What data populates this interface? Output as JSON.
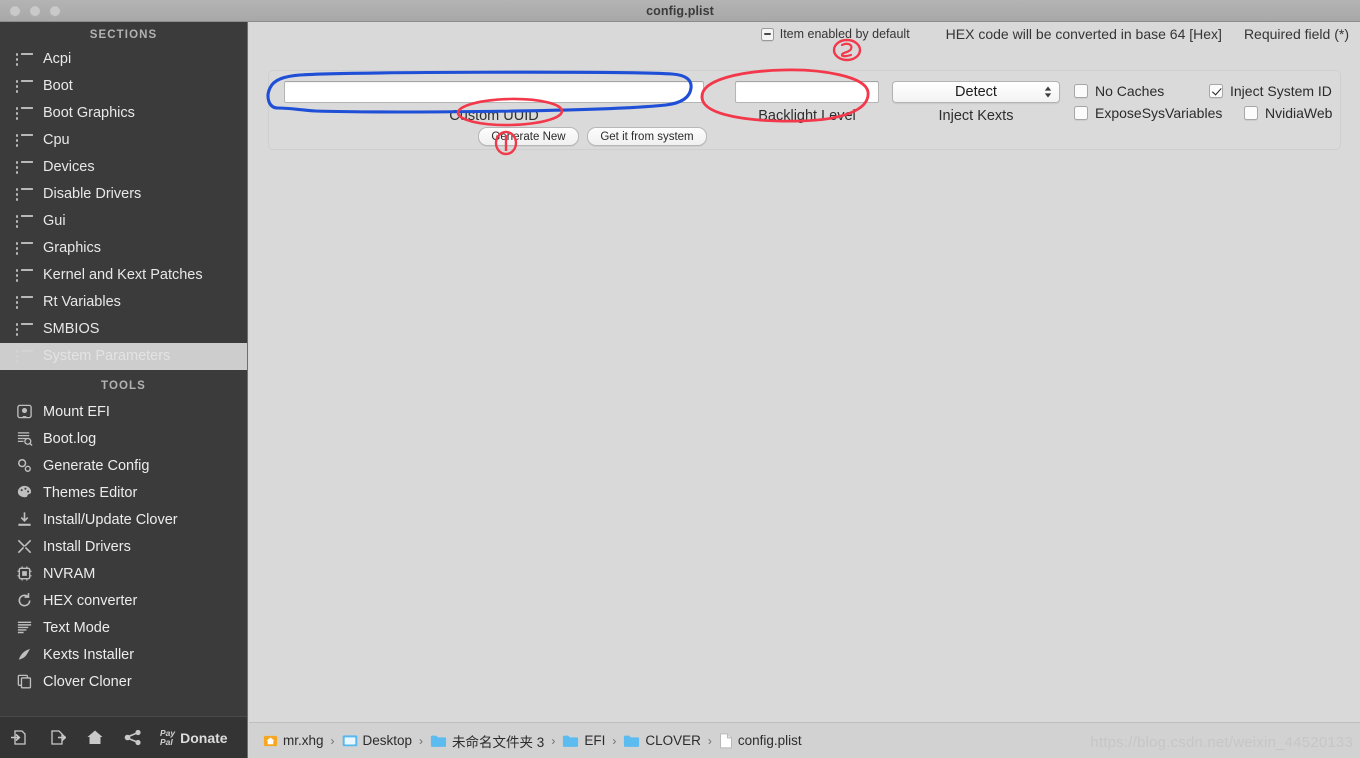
{
  "window": {
    "title": "config.plist"
  },
  "sidebar": {
    "sections_header": "SECTIONS",
    "sections": [
      {
        "label": "Acpi",
        "icon": "list-icon",
        "selected": false
      },
      {
        "label": "Boot",
        "icon": "list-icon",
        "selected": false
      },
      {
        "label": "Boot Graphics",
        "icon": "list-icon",
        "selected": false
      },
      {
        "label": "Cpu",
        "icon": "list-icon",
        "selected": false
      },
      {
        "label": "Devices",
        "icon": "list-icon",
        "selected": false
      },
      {
        "label": "Disable Drivers",
        "icon": "list-icon",
        "selected": false
      },
      {
        "label": "Gui",
        "icon": "list-icon",
        "selected": false
      },
      {
        "label": "Graphics",
        "icon": "list-icon",
        "selected": false
      },
      {
        "label": "Kernel and Kext Patches",
        "icon": "list-icon",
        "selected": false
      },
      {
        "label": "Rt Variables",
        "icon": "list-icon",
        "selected": false
      },
      {
        "label": "SMBIOS",
        "icon": "list-icon",
        "selected": false
      },
      {
        "label": "System Parameters",
        "icon": "list-icon",
        "selected": true
      }
    ],
    "tools_header": "TOOLS",
    "tools": [
      {
        "label": "Mount EFI",
        "icon": "disk-icon"
      },
      {
        "label": "Boot.log",
        "icon": "log-search-icon"
      },
      {
        "label": "Generate Config",
        "icon": "gears-icon"
      },
      {
        "label": "Themes Editor",
        "icon": "palette-icon"
      },
      {
        "label": "Install/Update Clover",
        "icon": "download-icon"
      },
      {
        "label": "Install Drivers",
        "icon": "tools-icon"
      },
      {
        "label": "NVRAM",
        "icon": "chip-icon"
      },
      {
        "label": "HEX converter",
        "icon": "refresh-icon"
      },
      {
        "label": "Text Mode",
        "icon": "text-lines-icon"
      },
      {
        "label": "Kexts Installer",
        "icon": "plug-icon"
      },
      {
        "label": "Clover Cloner",
        "icon": "copy-icon"
      }
    ],
    "footer": {
      "import_label": "import-icon",
      "export_label": "export-icon",
      "home_label": "home-icon",
      "share_label": "share-icon",
      "paypal_line1": "Pay",
      "paypal_line2": "Pal",
      "donate_label": "Donate"
    }
  },
  "legend": {
    "item_enabled": "Item enabled by default",
    "hex_note": "HEX code will be converted in base 64 [Hex]",
    "required_note": "Required field (*)"
  },
  "form": {
    "custom_uuid": {
      "label": "Custom UUID",
      "value": "",
      "placeholder": ""
    },
    "generate_new": "Generate New",
    "get_from_system": "Get it from system",
    "backlight_level": {
      "label": "Backlight Level",
      "value": "",
      "placeholder": ""
    },
    "inject_kexts": {
      "label": "Inject Kexts",
      "value": "Detect"
    },
    "checkboxes": [
      {
        "label": "No Caches",
        "checked": false
      },
      {
        "label": "Inject System ID",
        "checked": true
      },
      {
        "label": "ExposeSysVariables",
        "checked": false
      },
      {
        "label": "NvidiaWeb",
        "checked": false
      }
    ]
  },
  "breadcrumb": {
    "items": [
      {
        "label": "mr.xhg",
        "icon": "home-folder-icon"
      },
      {
        "label": "Desktop",
        "icon": "desktop-folder-icon"
      },
      {
        "label": "未命名文件夹 3",
        "icon": "folder-icon"
      },
      {
        "label": "EFI",
        "icon": "folder-icon"
      },
      {
        "label": "CLOVER",
        "icon": "folder-icon"
      },
      {
        "label": "config.plist",
        "icon": "file-icon"
      }
    ],
    "separator": "›"
  },
  "watermark": "https://blog.csdn.net/weixin_44520133",
  "annotations": {
    "marker_one": "①",
    "marker_two": "②",
    "blue_color": "#1e4fd6",
    "red_color": "#f2384a"
  }
}
